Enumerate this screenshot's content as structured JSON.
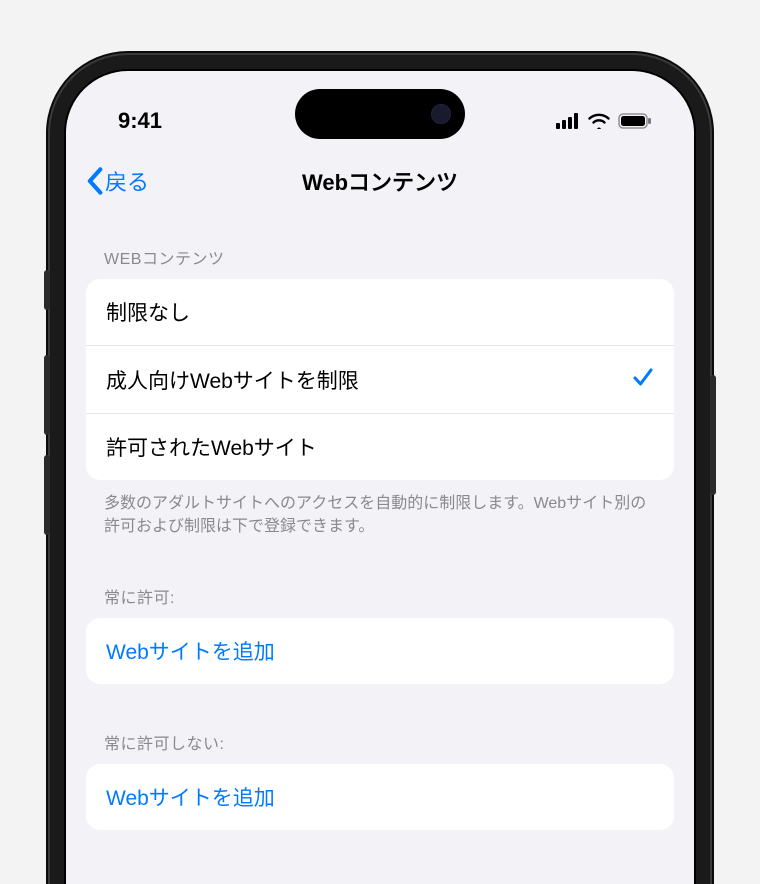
{
  "status": {
    "time": "9:41"
  },
  "nav": {
    "back_label": "戻る",
    "title": "Webコンテンツ"
  },
  "sections": {
    "web_content": {
      "header": "WEBコンテンツ",
      "options": [
        {
          "label": "制限なし",
          "selected": false
        },
        {
          "label": "成人向けWebサイトを制限",
          "selected": true
        },
        {
          "label": "許可されたWebサイト",
          "selected": false
        }
      ],
      "footer": "多数のアダルトサイトへのアクセスを自動的に制限します。Webサイト別の許可および制限は下で登録できます。"
    },
    "always_allow": {
      "header": "常に許可:",
      "add_label": "Webサイトを追加"
    },
    "never_allow": {
      "header": "常に許可しない:",
      "add_label": "Webサイトを追加"
    }
  },
  "colors": {
    "accent": "#007aff",
    "bg": "#f2f2f7",
    "card": "#ffffff",
    "secondary_text": "#8a8a8e"
  }
}
